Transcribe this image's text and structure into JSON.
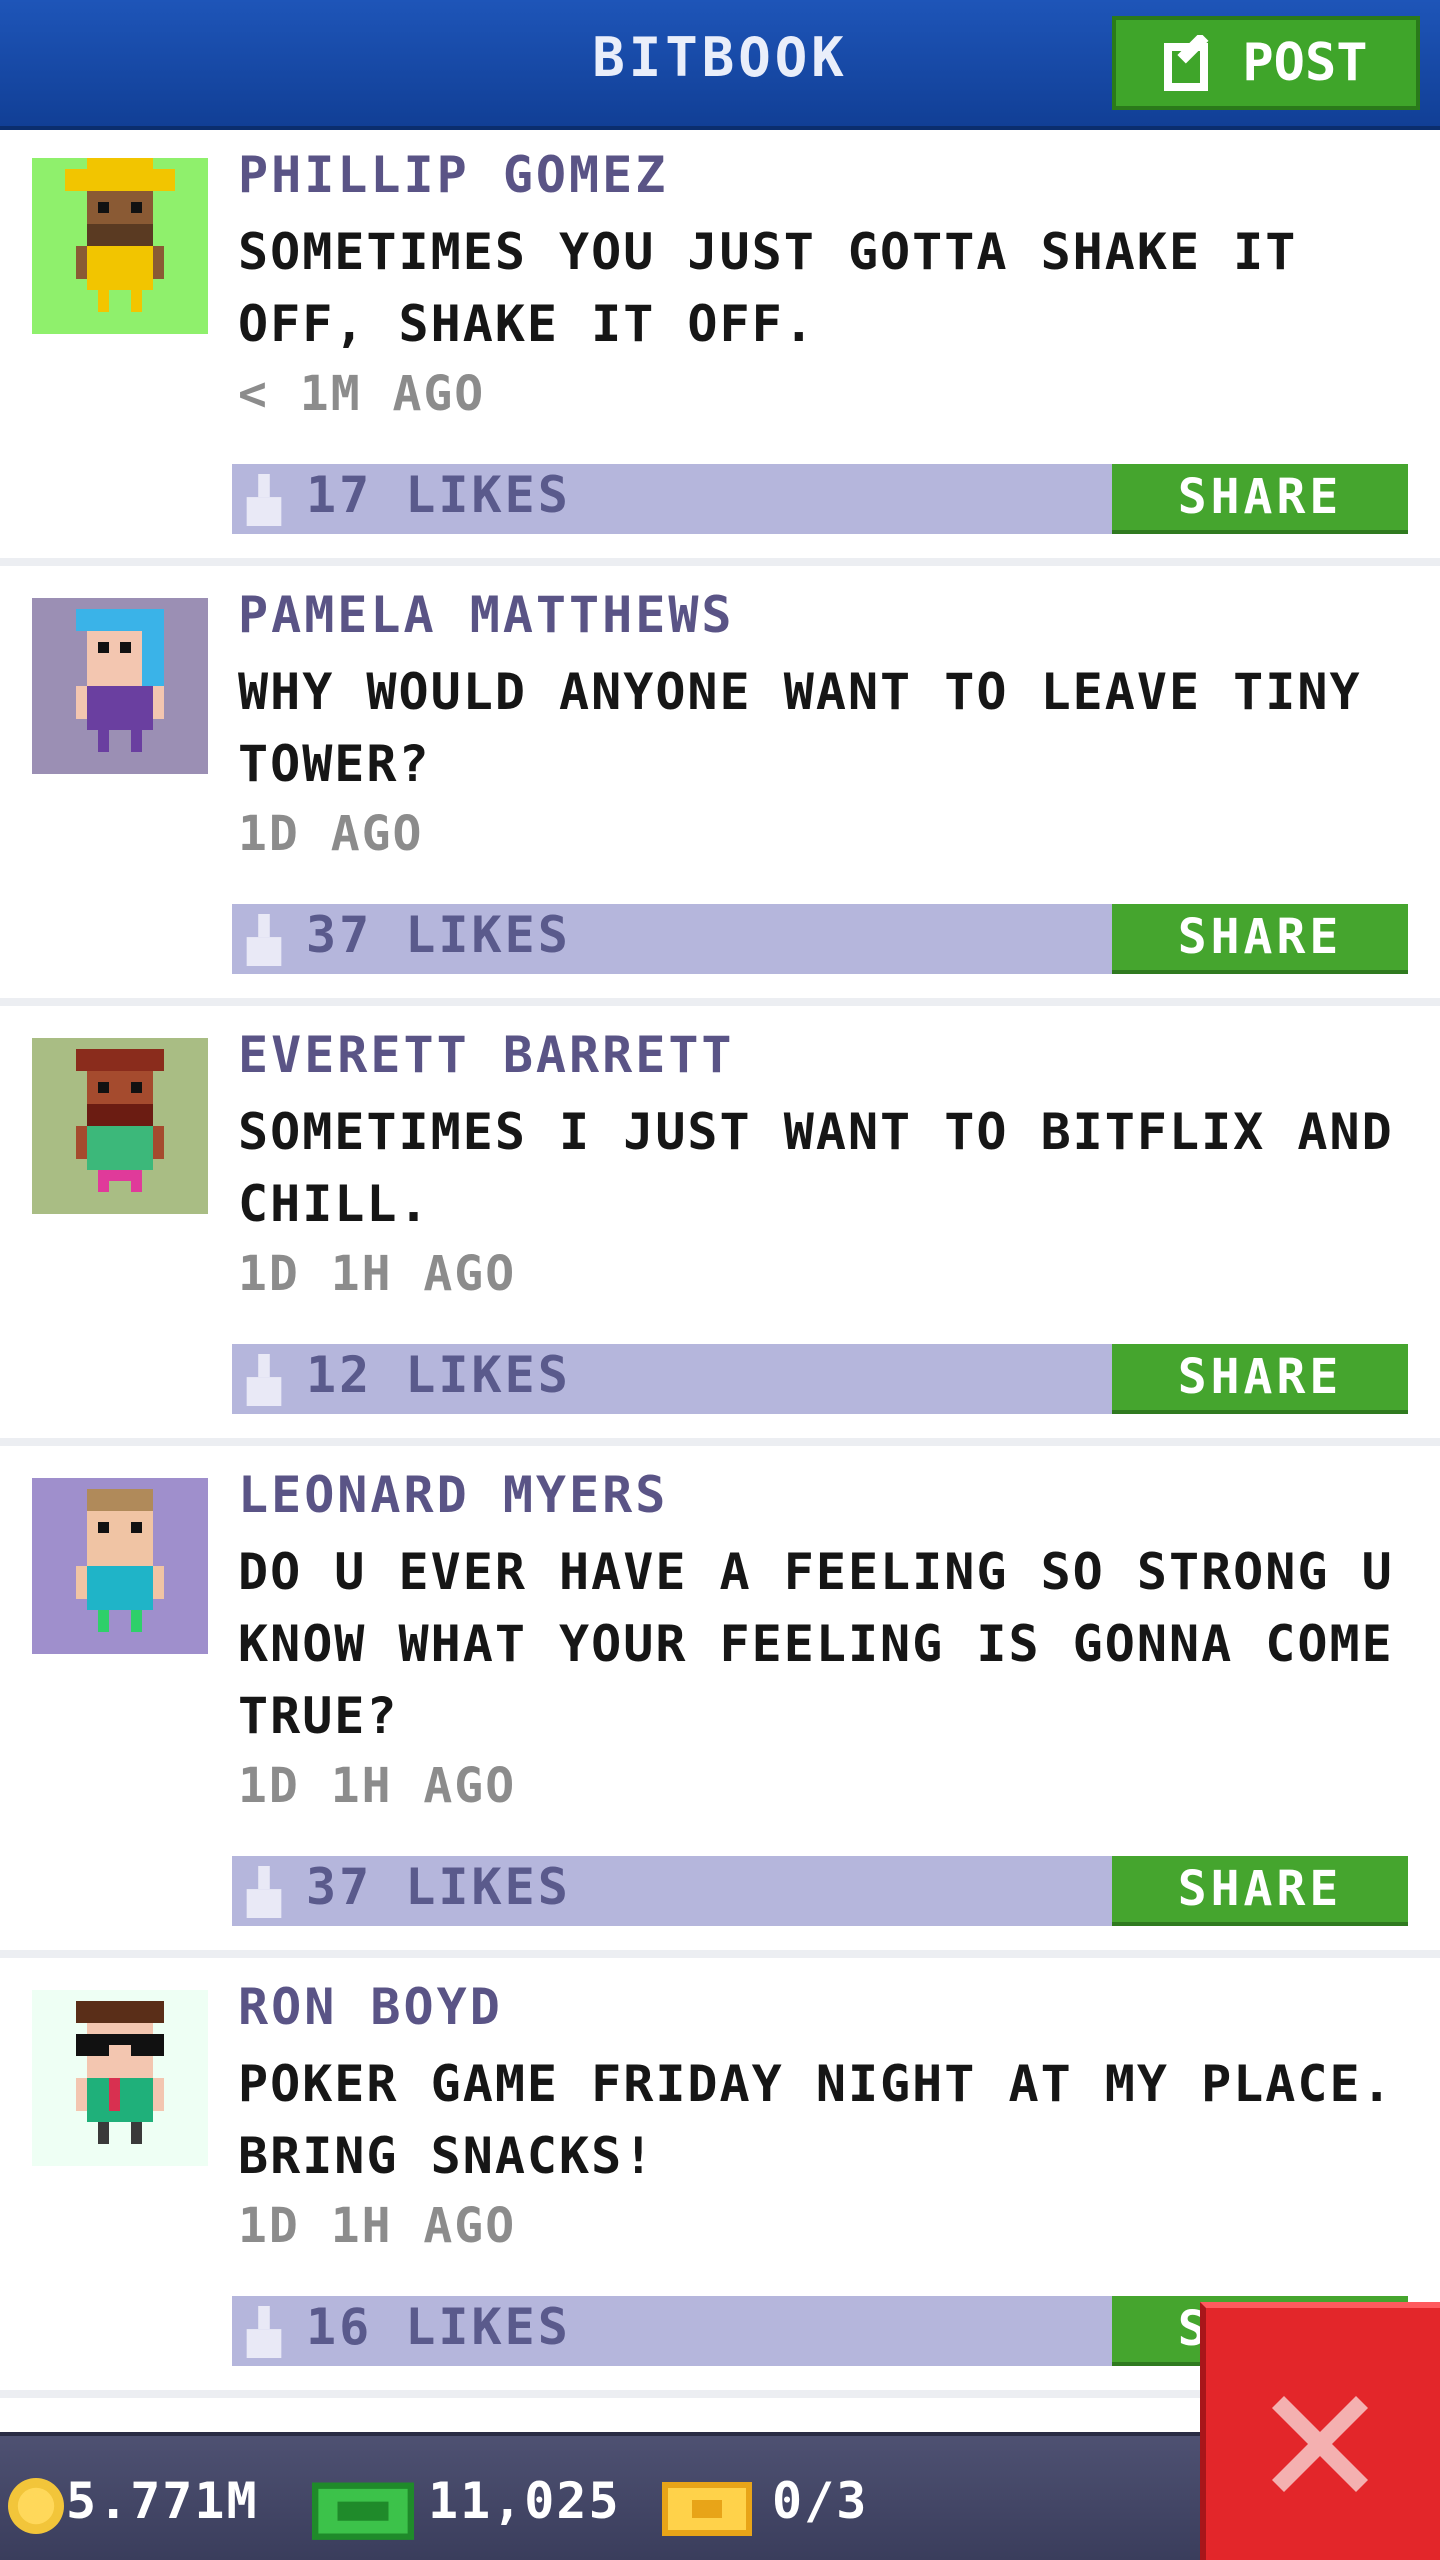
{
  "header": {
    "title": "BITBOOK",
    "post_label": "POST"
  },
  "posts": [
    {
      "author": "PHILLIP GOMEZ",
      "message": "SOMETIMES YOU JUST GOTTA SHAKE IT OFF, SHAKE IT OFF.",
      "time": "< 1M AGO",
      "likes": "17 LIKES",
      "share": "SHARE",
      "avatar_bg": "#8ff06c"
    },
    {
      "author": "PAMELA MATTHEWS",
      "message": "WHY WOULD ANYONE WANT TO LEAVE TINY TOWER?",
      "time": "1D AGO",
      "likes": "37 LIKES",
      "share": "SHARE",
      "avatar_bg": "#9b8fb4"
    },
    {
      "author": "EVERETT BARRETT",
      "message": "SOMETIMES I JUST WANT TO BITFLIX AND CHILL.",
      "time": "1D 1H AGO",
      "likes": "12 LIKES",
      "share": "SHARE",
      "avatar_bg": "#a9bd84"
    },
    {
      "author": "LEONARD MYERS",
      "message": "DO U EVER HAVE A FEELING SO STRONG U KNOW WHAT YOUR FEELING IS GONNA COME TRUE?",
      "time": "1D 1H AGO",
      "likes": "37 LIKES",
      "share": "SHARE",
      "avatar_bg": "#9f8fcc"
    },
    {
      "author": "RON BOYD",
      "message": "POKER GAME FRIDAY NIGHT AT MY PLACE. BRING SNACKS!",
      "time": "1D 1H AGO",
      "likes": "16 LIKES",
      "share": "SHARE",
      "avatar_bg": "#eefff4"
    }
  ],
  "footer": {
    "coins": "5.771M",
    "bux": "11,025",
    "tickets": "0/3"
  },
  "colors": {
    "header": "#1e55b8",
    "green_button": "#3fa52a",
    "like_bar": "#b5b6dc",
    "close_button": "#e3262a"
  }
}
